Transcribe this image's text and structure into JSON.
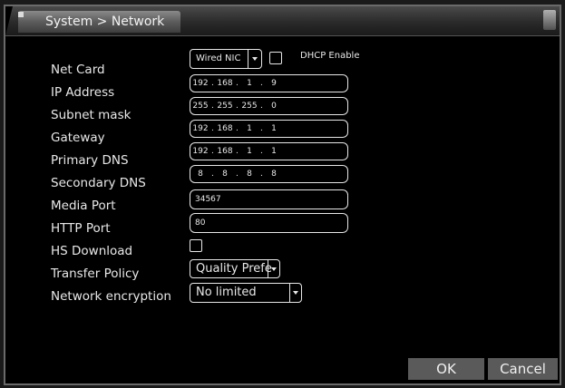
{
  "window": {
    "title": "System > Network"
  },
  "net_card": {
    "label": "Net Card",
    "value": "Wired NIC",
    "dhcp_label": "DHCP Enable",
    "dhcp_checked": false
  },
  "ip_address": {
    "label": "IP Address",
    "octets": [
      "192",
      "168",
      "1",
      "9"
    ]
  },
  "subnet_mask": {
    "label": "Subnet mask",
    "octets": [
      "255",
      "255",
      "255",
      "0"
    ]
  },
  "gateway": {
    "label": "Gateway",
    "octets": [
      "192",
      "168",
      "1",
      "1"
    ]
  },
  "primary_dns": {
    "label": "Primary DNS",
    "octets": [
      "192",
      "168",
      "1",
      "1"
    ]
  },
  "secondary_dns": {
    "label": "Secondary DNS",
    "octets": [
      "8",
      "8",
      "8",
      "8"
    ]
  },
  "media_port": {
    "label": "Media Port",
    "value": "34567"
  },
  "http_port": {
    "label": "HTTP Port",
    "value": "80"
  },
  "hs_download": {
    "label": "HS Download",
    "checked": false
  },
  "transfer_policy": {
    "label": "Transfer Policy",
    "value": "Quality Prefe"
  },
  "network_encryption": {
    "label": "Network encryption",
    "value": "No limited"
  },
  "buttons": {
    "ok": "OK",
    "cancel": "Cancel"
  },
  "colors": {
    "background": "#000000",
    "text": "#e8e8e8",
    "button": "#5a5a5a"
  }
}
